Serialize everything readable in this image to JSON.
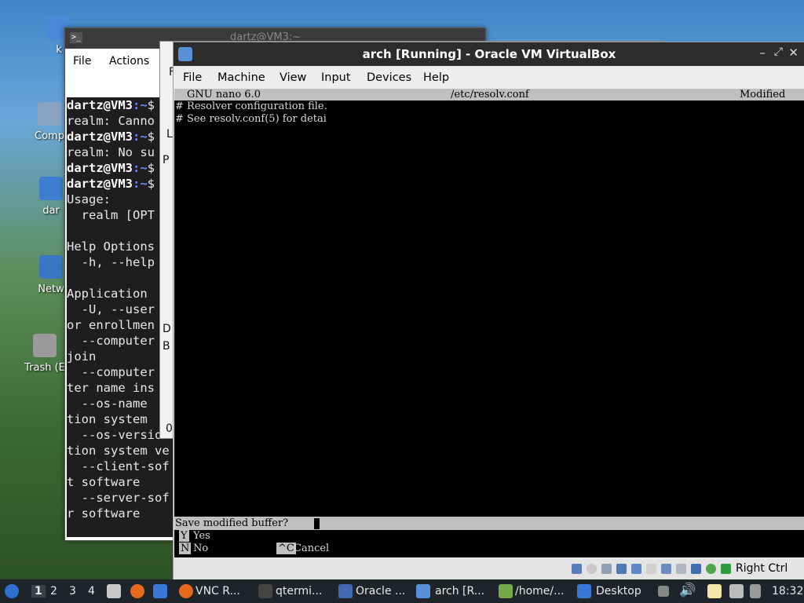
{
  "desktop": {
    "icons": [
      {
        "label": "k"
      },
      {
        "label": "Comp"
      },
      {
        "label": "dar"
      },
      {
        "label": "Netw"
      },
      {
        "label": "Trash (E"
      }
    ]
  },
  "terminal": {
    "title": "dartz@VM3:~",
    "menu": {
      "file": "File",
      "actions": "Actions"
    },
    "lines": [
      {
        "type": "prompt",
        "user": "dartz@VM3",
        "path": ":~",
        "sym": "$"
      },
      {
        "type": "text",
        "text": "realm: Canno"
      },
      {
        "type": "prompt",
        "user": "dartz@VM3",
        "path": ":~",
        "sym": "$"
      },
      {
        "type": "text",
        "text": "realm: No su"
      },
      {
        "type": "prompt",
        "user": "dartz@VM3",
        "path": ":~",
        "sym": "$"
      },
      {
        "type": "prompt",
        "user": "dartz@VM3",
        "path": ":~",
        "sym": "$"
      },
      {
        "type": "text",
        "text": "Usage:"
      },
      {
        "type": "text",
        "text": "  realm [OPT"
      },
      {
        "type": "text",
        "text": ""
      },
      {
        "type": "text",
        "text": "Help Options"
      },
      {
        "type": "text",
        "text": "  -h, --help"
      },
      {
        "type": "text",
        "text": ""
      },
      {
        "type": "text",
        "text": "Application "
      },
      {
        "type": "text",
        "text": "  -U, --user"
      },
      {
        "type": "text",
        "text": "or enrollmen"
      },
      {
        "type": "text",
        "text": "  --computer"
      },
      {
        "type": "text",
        "text": "join"
      },
      {
        "type": "text",
        "text": "  --computer"
      },
      {
        "type": "text",
        "text": "ter name ins"
      },
      {
        "type": "text",
        "text": "  --os-name "
      },
      {
        "type": "text",
        "text": "tion system "
      },
      {
        "type": "text",
        "text": "  --os-versio"
      },
      {
        "type": "text",
        "text": "tion system ve"
      },
      {
        "type": "text",
        "text": "  --client-sof"
      },
      {
        "type": "text",
        "text": "t software"
      },
      {
        "type": "text",
        "text": "  --server-sof"
      },
      {
        "type": "text",
        "text": "r software"
      }
    ]
  },
  "mid_window": {
    "frag_f": "F",
    "frag_l": "L",
    "frag_p": "P",
    "frag_d": "D",
    "frag_b": "B",
    "frag_0": "0"
  },
  "vbox": {
    "title": "arch [Running] - Oracle VM VirtualBox",
    "menu": {
      "file": "File",
      "machine": "Machine",
      "view": "View",
      "input": "Input",
      "devices": "Devices",
      "help": "Help"
    },
    "nano": {
      "app": "GNU nano 6.0",
      "file": "/etc/resolv.conf",
      "state": "Modified",
      "lines": [
        "# Resolver configuration file.",
        "# See resolv.conf(5) for detai"
      ],
      "prompt": "Save modified buffer? ",
      "opt_yes_key": "Y",
      "opt_yes": "Yes",
      "opt_no_key": "N",
      "opt_no": "No",
      "opt_cancel_key": "^C",
      "opt_cancel": "Cancel"
    },
    "host_key": "Right Ctrl"
  },
  "taskbar": {
    "workspaces": [
      "1",
      "2",
      "3",
      "4"
    ],
    "tasks": [
      {
        "label": "VNC R..."
      },
      {
        "label": "qtermi..."
      },
      {
        "label": "Oracle ..."
      },
      {
        "label": "arch [R..."
      },
      {
        "label": "/home/..."
      },
      {
        "label": "Desktop"
      }
    ],
    "clock": "18:32"
  },
  "colors": {
    "accent": "#3a7bd5",
    "terminal_path": "#6f8cff",
    "nano_bar": "#bfbfbf"
  }
}
